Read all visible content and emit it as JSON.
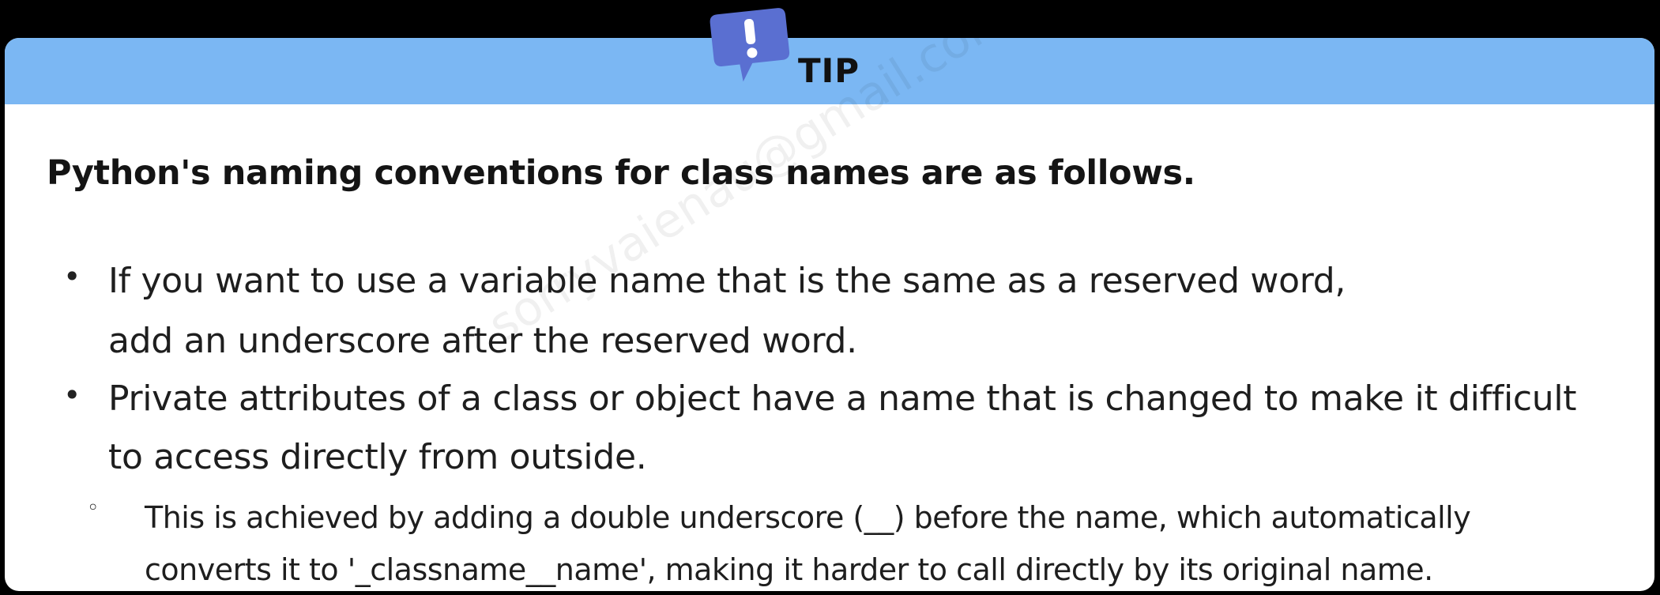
{
  "tip": {
    "label": "TIP",
    "icon": "exclamation-speech-bubble-icon",
    "icon_color": "#5a6fd1",
    "header_color": "#7bb7f3"
  },
  "heading": "Python's naming conventions for class names are as follows.",
  "bullets": [
    {
      "marker": "•",
      "lines": [
        "If you want to use a variable name that is the same as a reserved word,",
        "add an underscore after the reserved word."
      ]
    },
    {
      "marker": "•",
      "lines": [
        "Private attributes of a class or object have a name that is changed to make it difficult",
        "to access directly from outside."
      ]
    },
    {
      "marker": "◦",
      "lines": [
        "This is achieved by adding a double underscore (__) before the name, which automatically",
        "converts it to '_classname__name', making it harder to call directly by its original name."
      ]
    }
  ],
  "watermark": "sorryvaienau@gmail.com"
}
